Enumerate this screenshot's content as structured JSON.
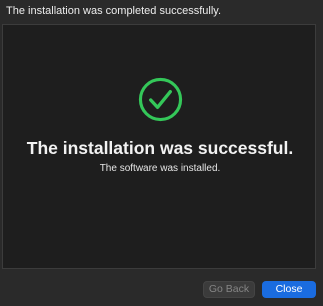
{
  "header": {
    "text": "The installation was completed successfully."
  },
  "content": {
    "icon": "checkmark-circle-icon",
    "headline": "The installation was successful.",
    "subtext": "The software was installed."
  },
  "buttons": {
    "go_back_label": "Go Back",
    "go_back_enabled": false,
    "close_label": "Close"
  },
  "colors": {
    "success_green": "#34c759",
    "accent_blue": "#1a6ce0"
  }
}
